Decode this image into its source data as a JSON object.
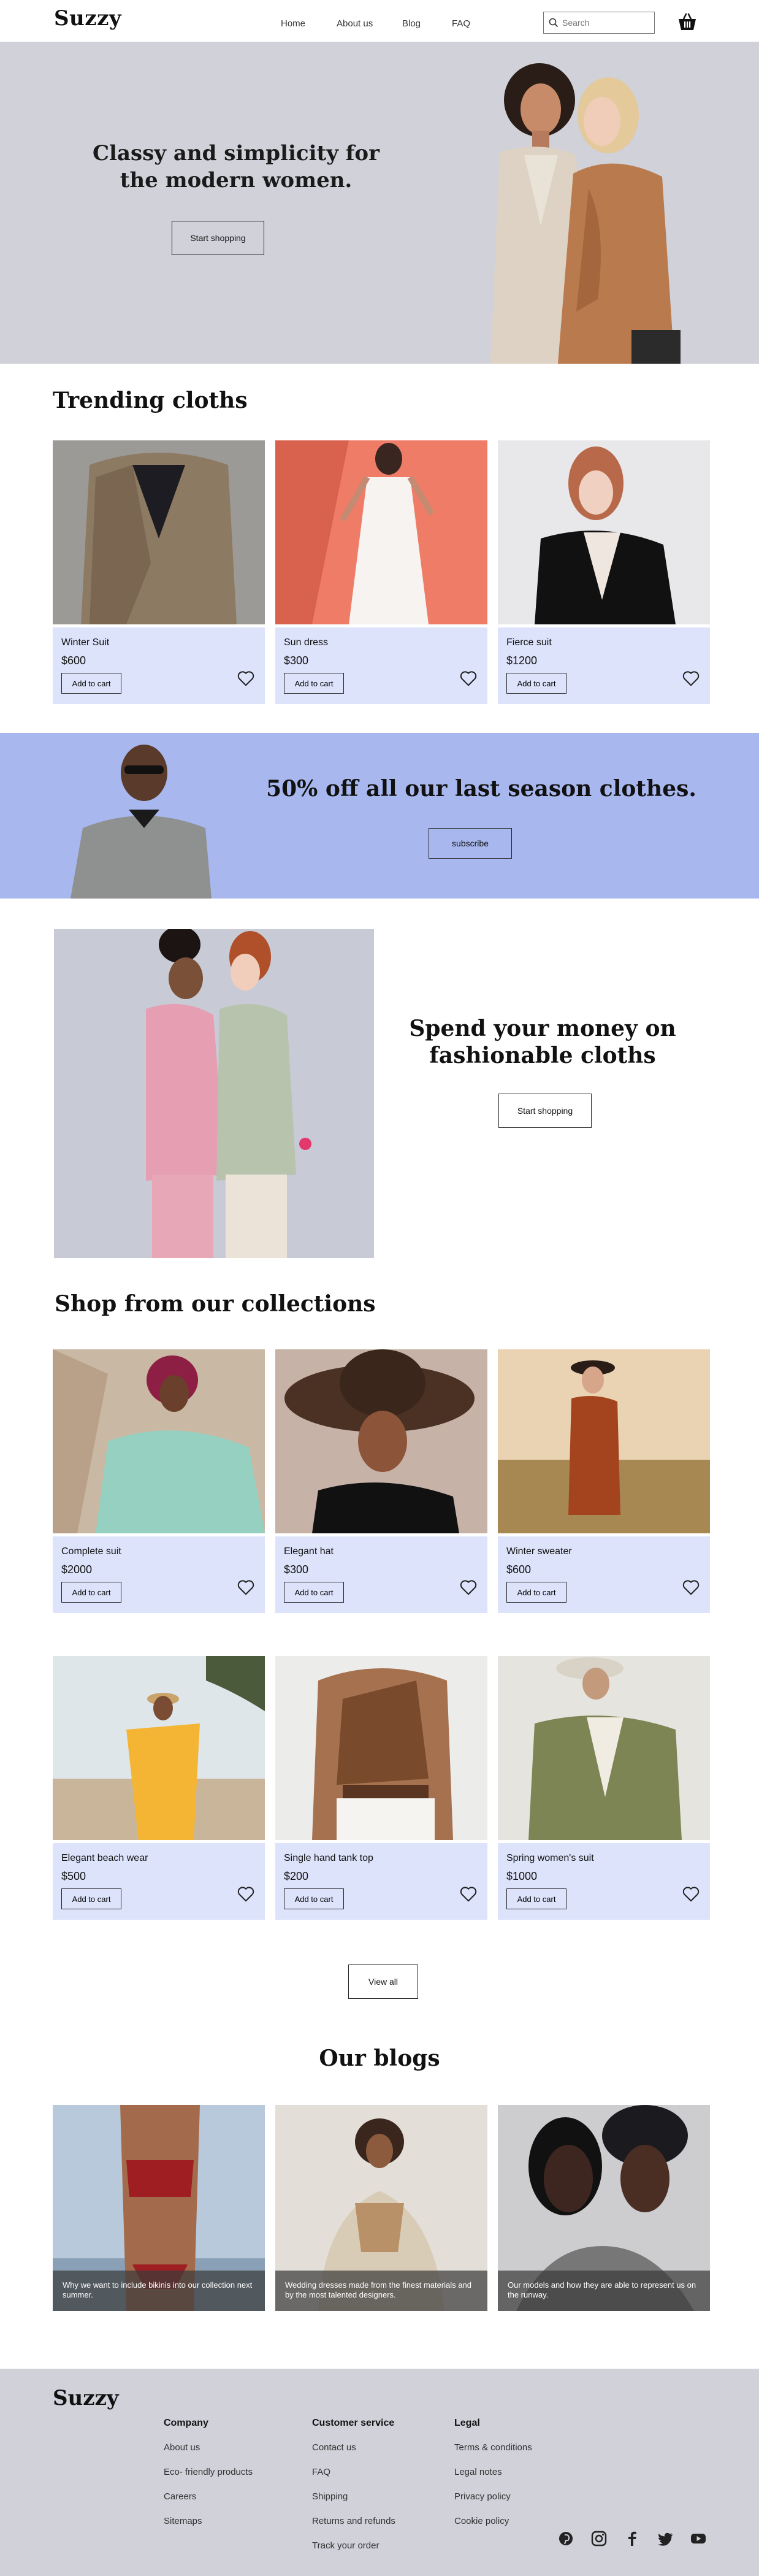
{
  "brand": "Suzzy",
  "nav": [
    "Home",
    "About us",
    "Blog",
    "FAQ"
  ],
  "search": {
    "placeholder": "Search"
  },
  "hero": {
    "title_line1": "Classy and simplicity for",
    "title_line2": "the modern women.",
    "cta": "Start shopping"
  },
  "trending": {
    "title": "Trending cloths",
    "items": [
      {
        "name": "Winter Suit",
        "price": "$600",
        "cta": "Add to cart"
      },
      {
        "name": "Sun dress",
        "price": "$300",
        "cta": "Add to cart"
      },
      {
        "name": "Fierce suit",
        "price": "$1200",
        "cta": "Add to cart"
      }
    ]
  },
  "promo": {
    "title": "50% off all our last season clothes.",
    "cta": "subscribe"
  },
  "split": {
    "title_line1": "Spend your money on",
    "title_line2": "fashionable cloths",
    "cta": "Start shopping"
  },
  "collections": {
    "title": "Shop from our collections",
    "items": [
      {
        "name": "Complete suit",
        "price": "$2000",
        "cta": "Add to cart"
      },
      {
        "name": "Elegant hat",
        "price": "$300",
        "cta": "Add to cart"
      },
      {
        "name": "Winter sweater",
        "price": "$600",
        "cta": "Add to cart"
      },
      {
        "name": "Elegant beach wear",
        "price": "$500",
        "cta": "Add to cart"
      },
      {
        "name": "Single hand tank top",
        "price": "$200",
        "cta": "Add to cart"
      },
      {
        "name": "Spring women's suit",
        "price": "$1000",
        "cta": "Add to cart"
      }
    ],
    "view_all": "View all"
  },
  "blogs": {
    "title": "Our blogs",
    "items": [
      {
        "caption": "Why we want to include bikinis into our collection next summer."
      },
      {
        "caption": "Wedding dresses made from the finest materials and by the most talented designers."
      },
      {
        "caption": "Our models and how they are able to represent us on the runway."
      }
    ]
  },
  "footer": {
    "brand": "Suzzy",
    "columns": [
      {
        "title": "Company",
        "links": [
          "About us",
          "Eco- friendly products",
          "Careers",
          "Sitemaps"
        ]
      },
      {
        "title": "Customer service",
        "links": [
          "Contact us",
          "FAQ",
          "Shipping",
          "Returns and refunds",
          "Track your order"
        ]
      },
      {
        "title": "Legal",
        "links": [
          "Terms & conditions",
          "Legal notes",
          "Privacy policy",
          "Cookie policy"
        ]
      }
    ],
    "social_icons": [
      "pinterest-icon",
      "instagram-icon",
      "facebook-icon",
      "twitter-icon",
      "youtube-icon"
    ]
  },
  "colors": {
    "hero_bg": "#d0d1d9",
    "card_info_bg": "#dde3fb",
    "promo_bg": "#a8b8ef",
    "footer_bg": "#d0d1d9"
  }
}
